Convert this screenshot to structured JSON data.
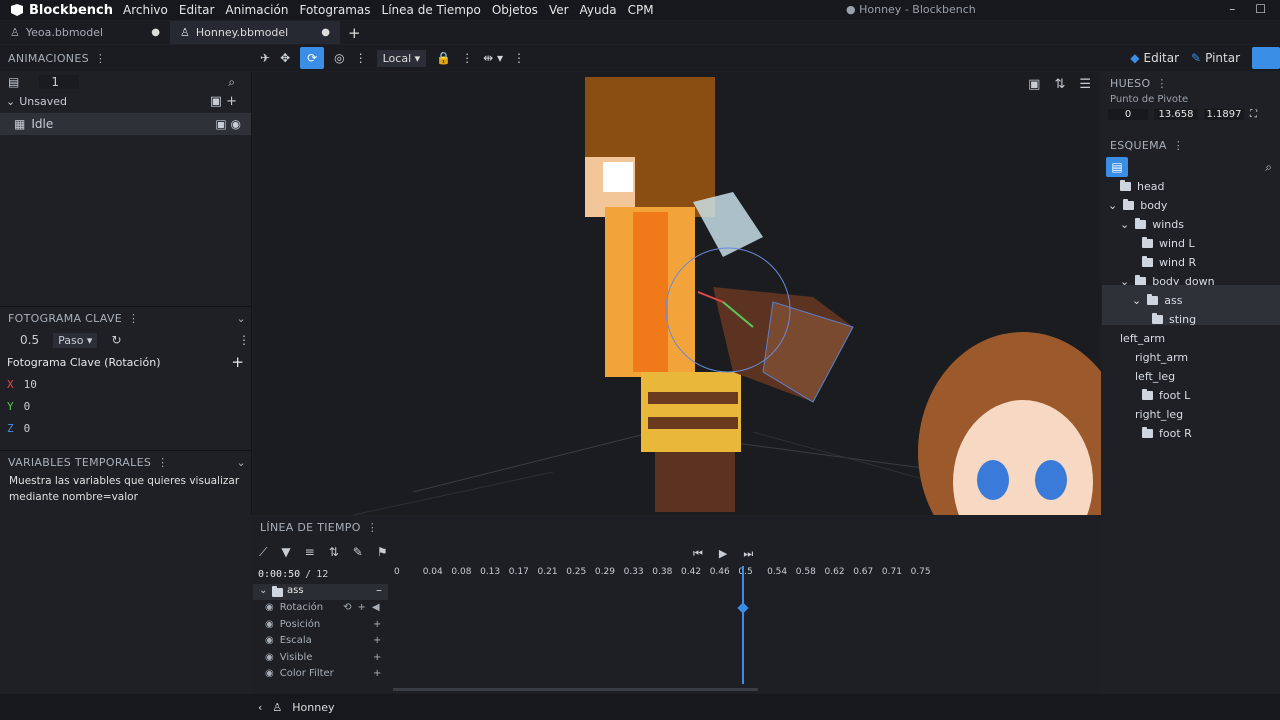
{
  "app": {
    "name": "Blockbench",
    "window_title": "● Honney - Blockbench"
  },
  "menu": [
    "Archivo",
    "Editar",
    "Animación",
    "Fotogramas",
    "Línea de Tiempo",
    "Objetos",
    "Ver",
    "Ayuda",
    "CPM"
  ],
  "tabs": [
    {
      "label": "Yeoa.bbmodel"
    },
    {
      "label": "Honney.bbmodel"
    }
  ],
  "toolbar": {
    "space": "Local",
    "modes": {
      "edit": "Editar",
      "paint": "Pintar"
    }
  },
  "animations": {
    "title": "ANIMACIONES",
    "count": "1",
    "group": "Unsaved",
    "items": [
      {
        "name": "Idle"
      }
    ]
  },
  "keyframe": {
    "title": "FOTOGRAMA CLAVE",
    "time": "0.5",
    "interpolation": "Paso",
    "channel": "Fotograma Clave (Rotación)",
    "x": "10",
    "y": "0",
    "z": "0",
    "x_label": "X",
    "y_label": "Y",
    "z_label": "Z"
  },
  "variables": {
    "title": "VARIABLES TEMPORALES",
    "text": "Muestra las variables que quieres visualizar mediante nombre=valor"
  },
  "bone": {
    "title": "HUESO",
    "pivot_label": "Punto de Pivote",
    "pivot": [
      "0",
      "13.658",
      "1.1897"
    ]
  },
  "outliner": {
    "title": "ESQUEMA",
    "items": [
      "head",
      "body",
      "winds",
      "wind L",
      "wind R",
      "body_down",
      "ass",
      "sting",
      "left_arm",
      "right_arm",
      "left_leg",
      "foot L",
      "right_leg",
      "foot R"
    ]
  },
  "timeline": {
    "title": "LÍNEA DE TIEMPO",
    "time": "0:00:50",
    "separator": "/",
    "total": "12",
    "ticks": [
      "0",
      "0.04",
      "0.08",
      "0.13",
      "0.17",
      "0.21",
      "0.25",
      "0.29",
      "0.33",
      "0.38",
      "0.42",
      "0.46",
      "0.5",
      "0.54",
      "0.58",
      "0.62",
      "0.67",
      "0.71",
      "0.75"
    ],
    "group": "ass",
    "tracks": [
      "Rotación",
      "Posición",
      "Escala",
      "Visible",
      "Color Filter"
    ],
    "playhead": 0.5
  },
  "status": {
    "model": "Honney"
  },
  "colors": {
    "accent": "#3a8ee6",
    "x": "#e04a4a",
    "y": "#5cc85c",
    "z": "#4a8ee0"
  }
}
